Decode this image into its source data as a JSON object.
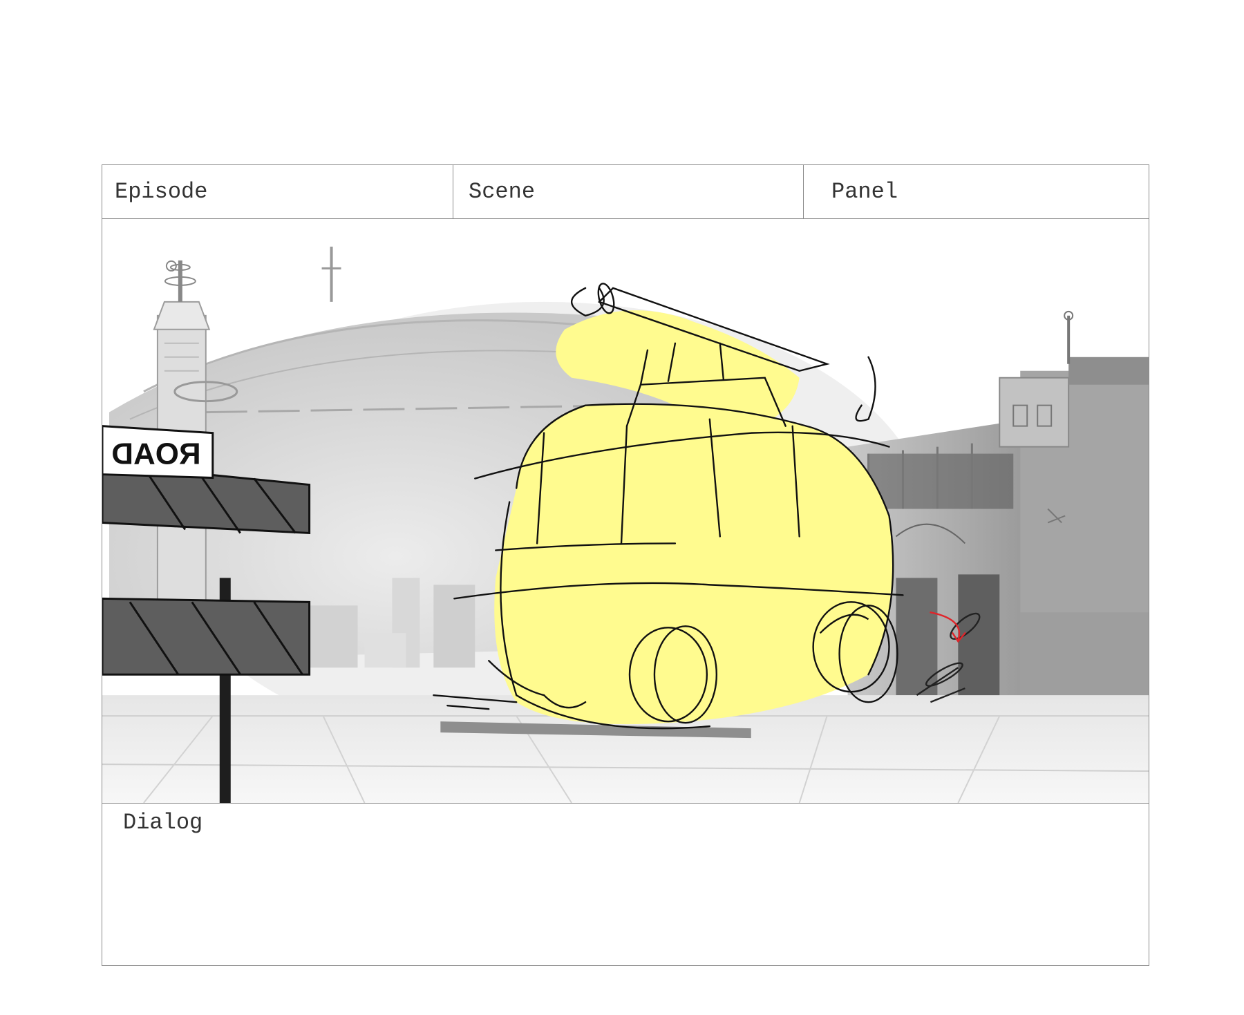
{
  "header": {
    "episode_label": "Episode",
    "scene_label": "Scene",
    "panel_label": "Panel"
  },
  "panel": {
    "sign_text": "ROAD",
    "colors": {
      "highlight": "#fffb8f",
      "sketch_line": "#111111",
      "barricade": "#5e5e5e",
      "background_tone": "#d9d9d9",
      "action_arrow": "#e0242a"
    }
  },
  "dialog": {
    "label": "Dialog"
  }
}
